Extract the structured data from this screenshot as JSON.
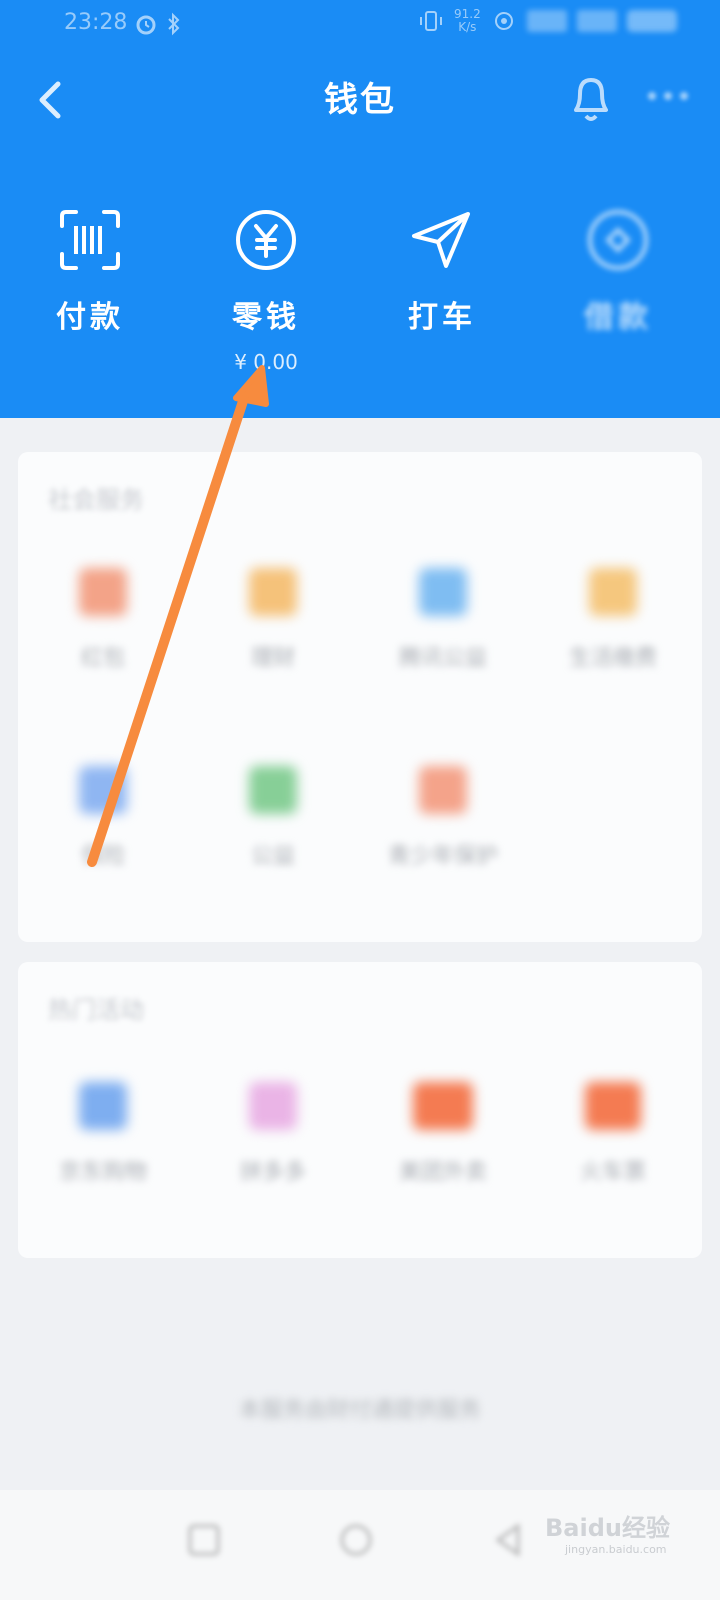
{
  "status_bar": {
    "time": "23:28",
    "speed": "91.2",
    "speed_unit": "K/s"
  },
  "nav": {
    "title": "钱包"
  },
  "actions": [
    {
      "label": "付款",
      "icon": "barcode-scan-icon"
    },
    {
      "label": "零钱",
      "icon": "yuan-circle-icon",
      "amount": "¥ 0.00"
    },
    {
      "label": "打车",
      "icon": "paper-plane-icon"
    },
    {
      "label": "借款",
      "icon": "diamond-circle-icon"
    }
  ],
  "sections": [
    {
      "title": "社会服务",
      "items": [
        {
          "label": "红包",
          "color": "#f3a388"
        },
        {
          "label": "理财",
          "color": "#f5c27a"
        },
        {
          "label": "腾讯公益",
          "color": "#7fbdf2"
        },
        {
          "label": "生活缴费",
          "color": "#f5c77e"
        },
        {
          "label": "保险",
          "color": "#8fb6f2"
        },
        {
          "label": "公益",
          "color": "#87cf97"
        },
        {
          "label": "青少年保护",
          "color": "#f4a38a"
        }
      ]
    },
    {
      "title": "热门活动",
      "items": [
        {
          "label": "京东购物",
          "color": "#7eaef0"
        },
        {
          "label": "拼多多",
          "color": "#eab4e6"
        },
        {
          "label": "美团外卖",
          "color": "#f47b52"
        },
        {
          "label": "火车票",
          "color": "#f47b52"
        }
      ]
    }
  ],
  "footer_note": "本服务由财付通提供服务",
  "arrow_color": "#f78b3e",
  "accent": "#1a8cf5",
  "watermark": {
    "brand": "Baidu经验",
    "url": "jingyan.baidu.com"
  }
}
